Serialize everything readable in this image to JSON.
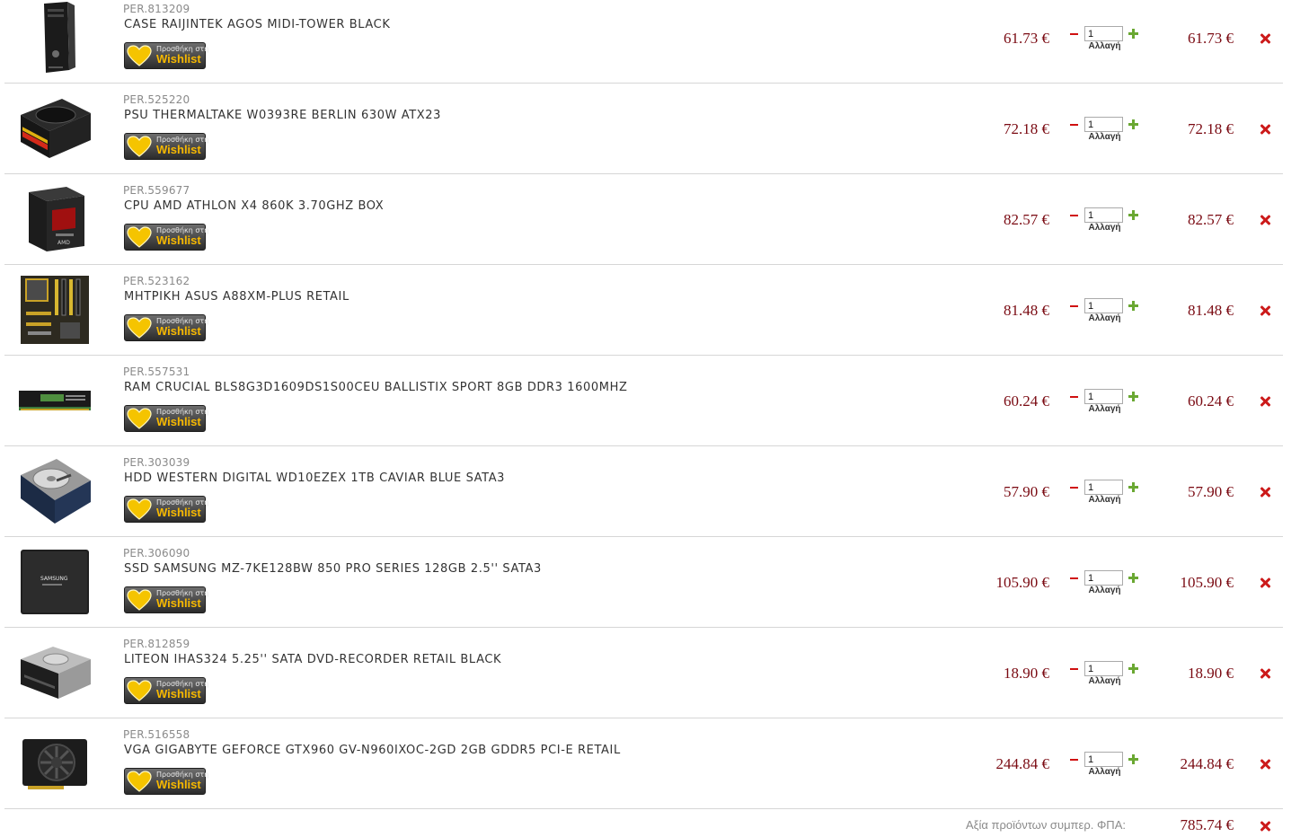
{
  "cart": {
    "currency_symbol": "€",
    "wishlist_button": {
      "line1": "Προσθήκη στη",
      "line2": "Wishlist"
    },
    "change_label": "Αλλαγή",
    "items": [
      {
        "code": "PER.813209",
        "name": "CASE RAIJINTEK AGOS MIDI-TOWER BLACK",
        "unit_price": "61.73 €",
        "quantity": "1",
        "total": "61.73 €",
        "image": "pc-case-thumbnail"
      },
      {
        "code": "PER.525220",
        "name": "PSU THERMALTAKE W0393RE BERLIN 630W ATX23",
        "unit_price": "72.18 €",
        "quantity": "1",
        "total": "72.18 €",
        "image": "power-supply-thumbnail"
      },
      {
        "code": "PER.559677",
        "name": "CPU AMD ATHLON X4 860K 3.70GHZ BOX",
        "unit_price": "82.57 €",
        "quantity": "1",
        "total": "82.57 €",
        "image": "cpu-box-thumbnail"
      },
      {
        "code": "PER.523162",
        "name": "ΜΗΤΡΙΚΗ ASUS A88XM-PLUS RETAIL",
        "unit_price": "81.48 €",
        "quantity": "1",
        "total": "81.48 €",
        "image": "motherboard-thumbnail"
      },
      {
        "code": "PER.557531",
        "name": "RAM CRUCIAL BLS8G3D1609DS1S00CEU BALLISTIX SPORT 8GB DDR3 1600MHZ",
        "unit_price": "60.24 €",
        "quantity": "1",
        "total": "60.24 €",
        "image": "ram-stick-thumbnail"
      },
      {
        "code": "PER.303039",
        "name": "HDD WESTERN DIGITAL WD10EZEX 1TB CAVIAR BLUE SATA3",
        "unit_price": "57.90 €",
        "quantity": "1",
        "total": "57.90 €",
        "image": "hard-drive-thumbnail"
      },
      {
        "code": "PER.306090",
        "name": "SSD SAMSUNG MZ-7KE128BW 850 PRO SERIES 128GB 2.5'' SATA3",
        "unit_price": "105.90 €",
        "quantity": "1",
        "total": "105.90 €",
        "image": "ssd-thumbnail"
      },
      {
        "code": "PER.812859",
        "name": "LITEON IHAS324 5.25'' SATA DVD-RECORDER RETAIL BLACK",
        "unit_price": "18.90 €",
        "quantity": "1",
        "total": "18.90 €",
        "image": "dvd-drive-thumbnail"
      },
      {
        "code": "PER.516558",
        "name": "VGA GIGABYTE GEFORCE GTX960 GV-N960IXOC-2GD 2GB GDDR5 PCI-E RETAIL",
        "unit_price": "244.84 €",
        "quantity": "1",
        "total": "244.84 €",
        "image": "graphics-card-thumbnail"
      }
    ],
    "summary": {
      "label": "Αξία προϊόντων συμπερ. ΦΠΑ:",
      "total": "785.74 €"
    }
  },
  "colors": {
    "price": "#7a0a12",
    "remove": "#cc1a1a",
    "decrease": "#d01010",
    "increase": "#6aa832",
    "wishlist_text": "#f6b800",
    "row_divider": "#d6d6d6"
  }
}
